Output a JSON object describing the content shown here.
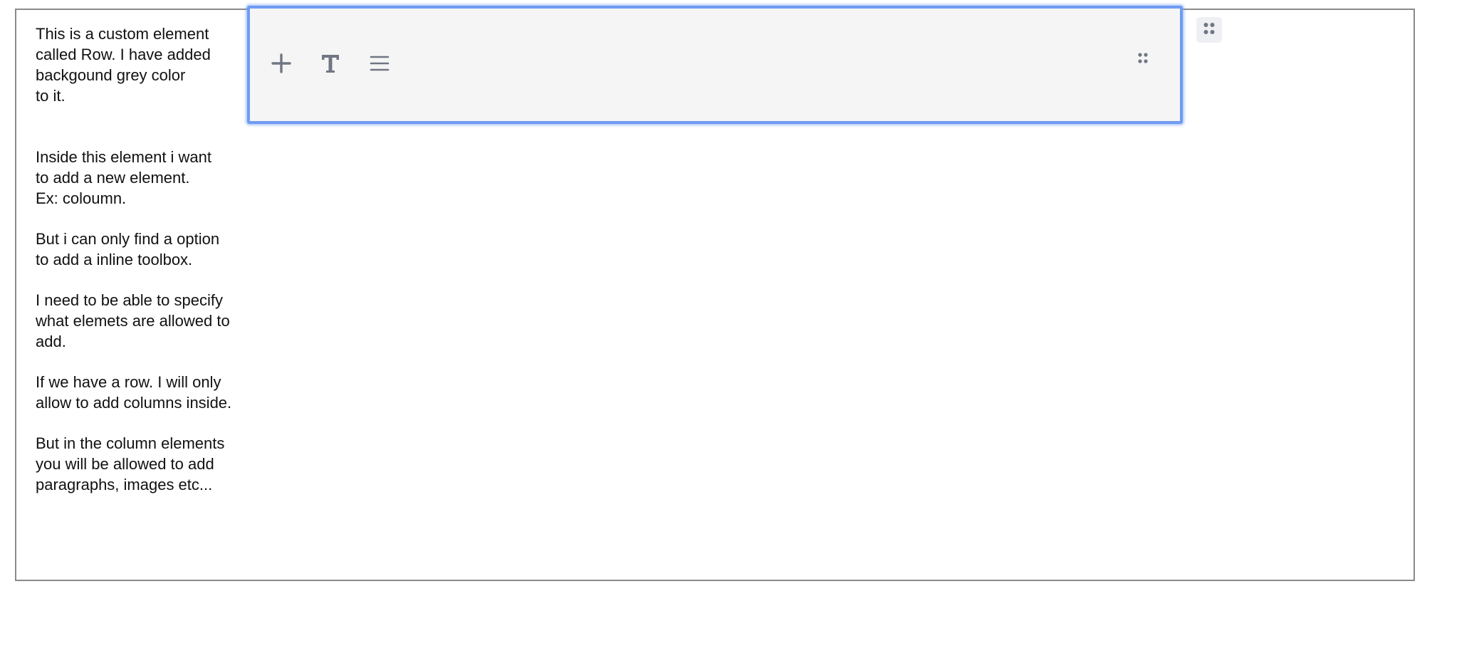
{
  "notes": {
    "paragraphs": [
      "This is a custom element\ncalled Row. I have added\nbackgound grey color\nto it.",
      "Inside this element i want\nto add a new element.\nEx: coloumn.",
      "But i can only find a option\nto add a inline toolbox.",
      "I need to be able to specify\nwhat elemets are allowed to\nadd.",
      "If we have a row. I will only\nallow to add columns inside.",
      "But in the column elements\nyou will be allowed to add\nparagraphs, images etc..."
    ]
  },
  "row_block": {
    "toolbar": [
      {
        "icon": "plus-icon"
      },
      {
        "icon": "text-icon",
        "glyph": "T"
      },
      {
        "icon": "align-icon"
      }
    ],
    "drag_icon": "drag-handle-icon",
    "background": "#f5f5f5",
    "focus_border": "#6f9bf2"
  },
  "outer_drag": {
    "icon": "drag-handle-icon",
    "background": "#eef0f4"
  },
  "colors": {
    "icon": "#707684",
    "frame_border": "#8a8a8a",
    "text": "#111111"
  }
}
